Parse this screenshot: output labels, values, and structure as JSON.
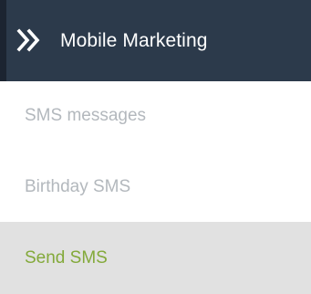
{
  "header": {
    "title": "Mobile Marketing",
    "icon": "double-chevron-right-icon"
  },
  "items": [
    {
      "label": "SMS messages",
      "active": false
    },
    {
      "label": "Birthday SMS",
      "active": false
    },
    {
      "label": "Send SMS",
      "active": true
    }
  ],
  "colors": {
    "header_bg": "#2c3a4b",
    "header_text": "#ffffff",
    "item_text": "#b3b8bd",
    "active_bg": "#e1e1e1",
    "active_text": "#83a93a"
  }
}
